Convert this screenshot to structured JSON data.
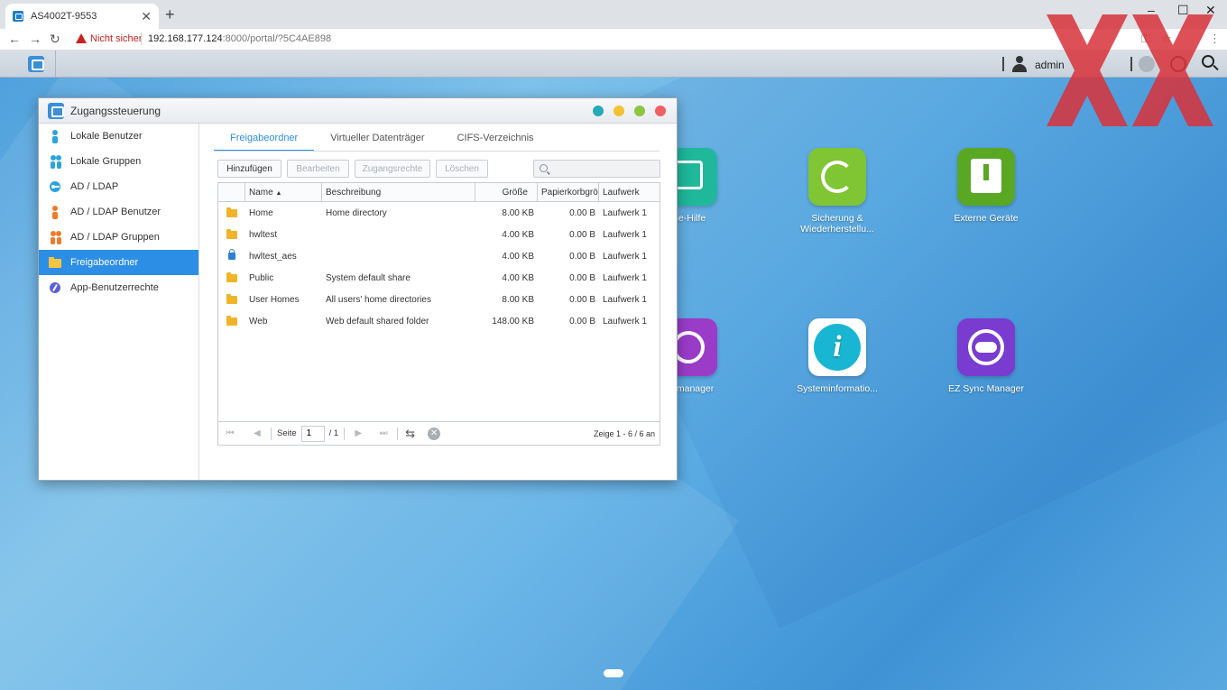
{
  "browser": {
    "tab_title": "AS4002T-9553",
    "not_secure": "Nicht sicher",
    "url_host": "192.168.177.124",
    "url_path": ":8000/portal/?5C4AE898"
  },
  "topbar": {
    "username": "admin"
  },
  "desktop_icons": [
    {
      "label": "Online-Hilfe",
      "visible_label": "ine-Hilfe",
      "color": "#1fb89a"
    },
    {
      "label": "Sicherung & Wiederherstellu...",
      "color": "#7fc534"
    },
    {
      "label": "Externe Geräte",
      "color": "#5aa724"
    },
    {
      "label": "Speichermanager",
      "visible_label": "hermanager",
      "color": "#9b3cc8"
    },
    {
      "label": "Systeminformatio...",
      "color": "#19b6d4"
    },
    {
      "label": "EZ Sync Manager",
      "color": "#7a3bd1"
    }
  ],
  "window": {
    "title": "Zugangssteuerung",
    "sidebar": [
      {
        "label": "Lokale Benutzer",
        "icon": "user-icon"
      },
      {
        "label": "Lokale Gruppen",
        "icon": "group-icon"
      },
      {
        "label": "AD / LDAP",
        "icon": "key-icon"
      },
      {
        "label": "AD / LDAP Benutzer",
        "icon": "user-icon"
      },
      {
        "label": "AD / LDAP Gruppen",
        "icon": "group-icon"
      },
      {
        "label": "Freigabeordner",
        "icon": "folder-icon"
      },
      {
        "label": "App-Benutzerrechte",
        "icon": "app-icon"
      }
    ],
    "tabs": [
      "Freigabeordner",
      "Virtueller Datenträger",
      "CIFS-Verzeichnis"
    ],
    "toolbar": {
      "add": "Hinzufügen",
      "edit": "Bearbeiten",
      "access": "Zugangsrechte",
      "delete": "Löschen"
    },
    "columns": [
      "Name",
      "Beschreibung",
      "Größe",
      "Papierkorbgröß",
      "Laufwerk"
    ],
    "rows": [
      {
        "name": "Home",
        "desc": "Home directory",
        "size": "8.00 KB",
        "bin": "0.00 B",
        "drive": "Laufwerk 1",
        "icon": "folder-icon"
      },
      {
        "name": "hwltest",
        "desc": "",
        "size": "4.00 KB",
        "bin": "0.00 B",
        "drive": "Laufwerk 1",
        "icon": "folder-icon"
      },
      {
        "name": "hwltest_aes",
        "desc": "",
        "size": "4.00 KB",
        "bin": "0.00 B",
        "drive": "Laufwerk 1",
        "icon": "lock-icon"
      },
      {
        "name": "Public",
        "desc": "System default share",
        "size": "4.00 KB",
        "bin": "0.00 B",
        "drive": "Laufwerk 1",
        "icon": "folder-icon"
      },
      {
        "name": "User Homes",
        "desc": "All users' home directories",
        "size": "8.00 KB",
        "bin": "0.00 B",
        "drive": "Laufwerk 1",
        "icon": "folder-icon"
      },
      {
        "name": "Web",
        "desc": "Web default shared folder",
        "size": "148.00 KB",
        "bin": "0.00 B",
        "drive": "Laufwerk 1",
        "icon": "folder-icon"
      }
    ],
    "pager": {
      "page_label": "Seite",
      "page_value": "1",
      "page_total": "/ 1",
      "summary": "Zeige 1 - 6 / 6 an"
    }
  },
  "colors": {
    "accent": "#2d8ee6",
    "watermark": "#d9323a"
  }
}
